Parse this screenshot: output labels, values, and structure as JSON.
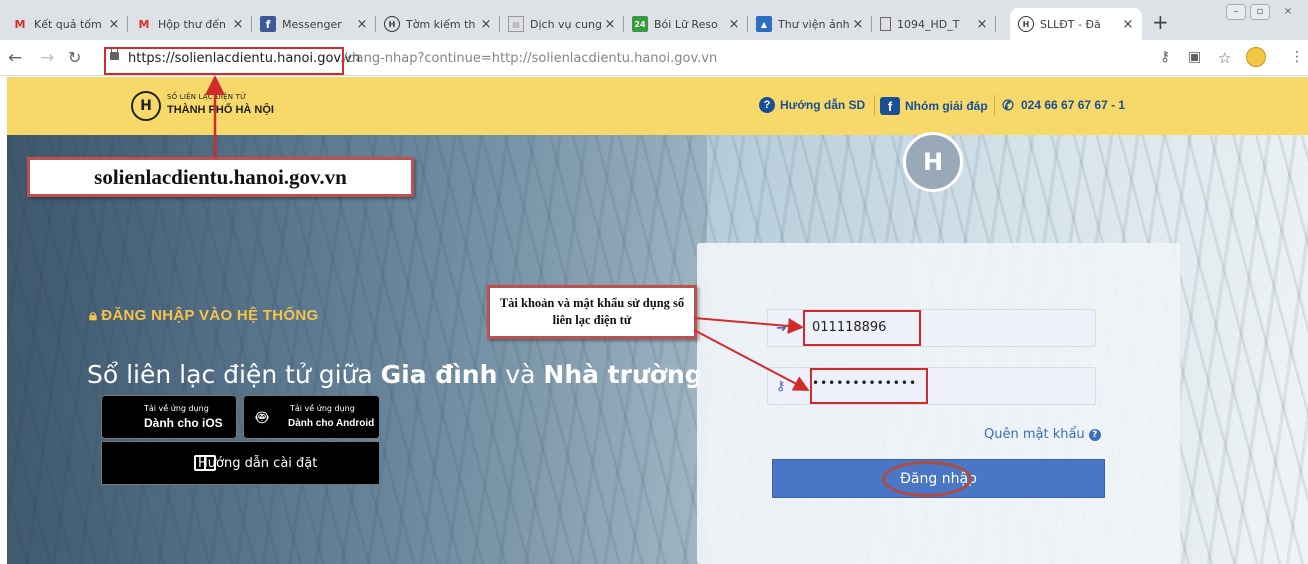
{
  "browser": {
    "tabs": [
      {
        "title": "Kết quả tốm",
        "favicon": "gmail-icon"
      },
      {
        "title": "Hộp thư đến",
        "favicon": "gmail-icon"
      },
      {
        "title": "Messenger",
        "favicon": "facebook-icon"
      },
      {
        "title": "Tờm kiếm th",
        "favicon": "hanoi-logo-icon"
      },
      {
        "title": "Dịch vụ cung",
        "favicon": "document-icon"
      },
      {
        "title": "Bói Lữ Reso",
        "favicon": "24-icon"
      },
      {
        "title": "Thư viện ảnh",
        "favicon": "image-icon"
      },
      {
        "title": "1094_HD_T",
        "favicon": "file-icon"
      },
      {
        "title": "SLLĐT - Đă",
        "favicon": "hanoi-logo-icon",
        "active": true
      }
    ],
    "url_host": "https://solienlacdientu.hanoi.gov.vn",
    "url_path": "/dang-nhap?continue=http://solienlacdientu.hanoi.gov.vn"
  },
  "header": {
    "brand_small": "SỐ LIÊN LẠC ĐIỆN TỬ",
    "brand_main": "THÀNH PHỐ HÀ NỘI",
    "links": [
      {
        "label": "Hướng dẫn SD",
        "icon": "question-icon"
      },
      {
        "label": "Nhóm giải đáp",
        "icon": "facebook-icon"
      },
      {
        "label": "024 66 67 67 67 - 1",
        "icon": "phone-icon"
      }
    ]
  },
  "annotations": {
    "url_callout": "solienlacdientu.hanoi.gov.vn",
    "credentials_callout": "Tài khoản và mật khẩu sử dụng sổ liên lạc điện tử",
    "accent_color": "#d12b2b"
  },
  "hero": {
    "login_title": "ĐĂNG NHẬP VÀO HỆ THỐNG",
    "tagline_prefix": "Sổ liên lạc điện tử giữa ",
    "tagline_bold1": "Gia đình",
    "tagline_mid": " và ",
    "tagline_bold2": "Nhà trường",
    "ios_small": "Tải về ứng dụng",
    "ios_main": "Dành cho iOS",
    "android_small": "Tải về ứng dụng",
    "android_main": "Dành cho Android",
    "guide_label": "Hướng dẫn cài đặt"
  },
  "login": {
    "username_value": "011118896",
    "password_value": "•••••••••••••",
    "forgot_label": "Quên mật khẩu",
    "submit_label": "Đăng nhập",
    "button_color": "#4a76c6"
  }
}
